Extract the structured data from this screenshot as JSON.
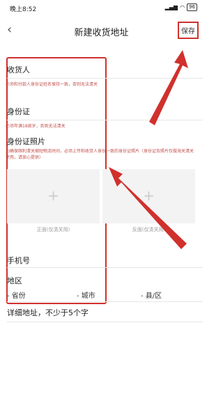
{
  "status": {
    "time": "晚上8:52",
    "battery": "96"
  },
  "header": {
    "title": "新建收货地址",
    "save_label": "保存"
  },
  "receiver": {
    "label": "收货人",
    "hint": "必须和付款人身份证姓名保持一致，否则无法清关"
  },
  "idcard": {
    "label": "身份证",
    "hint": "必须年满18周岁，否则无法清关"
  },
  "idphoto": {
    "label": "身份证照片",
    "hint": "为确保顺利清关缩短物流时间，必须上传和收货人身份一致的身份证照片（身份证及照片仅做海关清关使用，请放心提供）",
    "front_caption": "正面(仅清关用)",
    "back_caption": "反面(仅清关用)"
  },
  "phone": {
    "label": "手机号"
  },
  "region": {
    "label": "地区",
    "province": "- 省份",
    "city": "- 城市",
    "county": "- 县/区"
  },
  "address": {
    "placeholder": "详细地址，不少于5个字"
  },
  "colors": {
    "accent": "#d0312d"
  }
}
